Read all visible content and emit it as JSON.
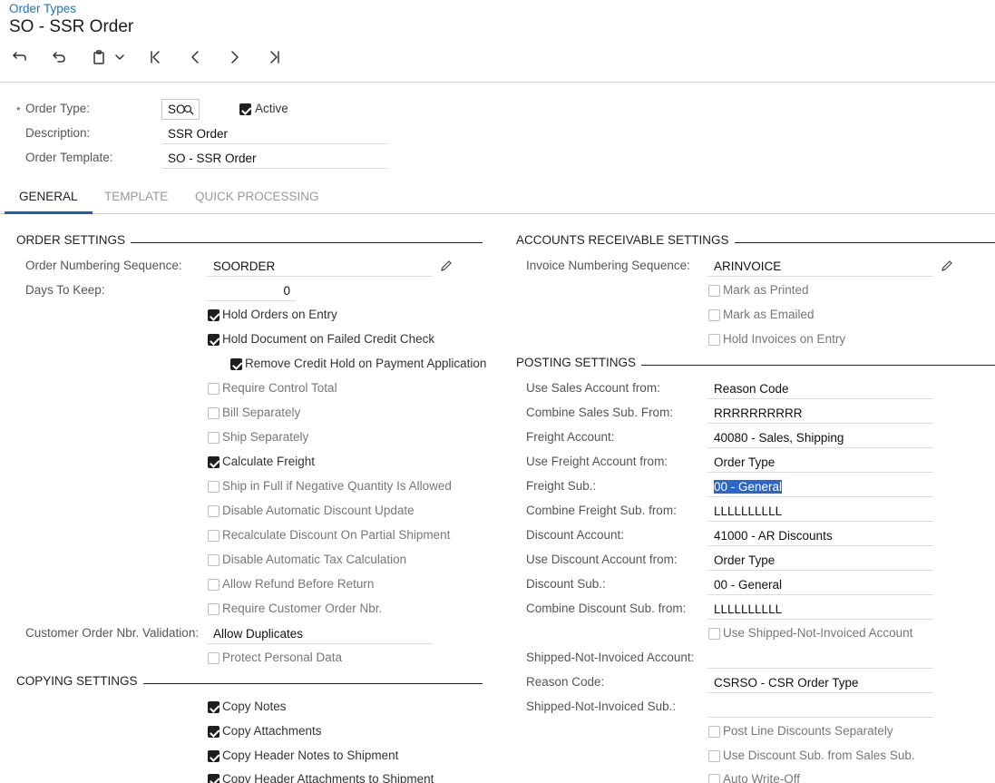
{
  "breadcrumb": "Order Types",
  "title": "SO - SSR Order",
  "toolbar": [
    "undo-arrow-icon",
    "undo-icon",
    "clipboard-icon",
    "chevron-down-icon",
    "first-record-icon",
    "prev-record-icon",
    "next-record-icon",
    "last-record-icon"
  ],
  "header": {
    "order_type_label": "Order Type:",
    "order_type_value": "SO",
    "active_label": "Active",
    "active_checked": true,
    "description_label": "Description:",
    "description_value": "SSR Order",
    "template_label": "Order Template:",
    "template_value": "SO - SSR Order"
  },
  "tabs": [
    "GENERAL",
    "TEMPLATE",
    "QUICK PROCESSING"
  ],
  "order_settings": {
    "title": "ORDER SETTINGS",
    "numbering_label": "Order Numbering Sequence:",
    "numbering_value": "SOORDER",
    "days_label": "Days To Keep:",
    "days_value": "0",
    "checkboxes": [
      {
        "label": "Hold Orders on Entry",
        "checked": true
      },
      {
        "label": "Hold Document on Failed Credit Check",
        "checked": true
      },
      {
        "label": "Remove Credit Hold on Payment Application",
        "checked": true
      },
      {
        "label": "Require Control Total",
        "checked": false
      },
      {
        "label": "Bill Separately",
        "checked": false
      },
      {
        "label": "Ship Separately",
        "checked": false
      },
      {
        "label": "Calculate Freight",
        "checked": true
      },
      {
        "label": "Ship in Full if Negative Quantity Is Allowed",
        "checked": false
      },
      {
        "label": "Disable Automatic Discount Update",
        "checked": false
      },
      {
        "label": "Recalculate Discount On Partial Shipment",
        "checked": false
      },
      {
        "label": "Disable Automatic Tax Calculation",
        "checked": false
      },
      {
        "label": "Allow Refund Before Return",
        "checked": false
      },
      {
        "label": "Require Customer Order Nbr.",
        "checked": false
      }
    ],
    "validation_label": "Customer Order Nbr. Validation:",
    "validation_value": "Allow Duplicates",
    "protect_label": "Protect Personal Data",
    "protect_checked": false
  },
  "copying_settings": {
    "title": "COPYING SETTINGS",
    "checkboxes": [
      {
        "label": "Copy Notes",
        "checked": true
      },
      {
        "label": "Copy Attachments",
        "checked": true
      },
      {
        "label": "Copy Header Notes to Shipment",
        "checked": true
      },
      {
        "label": "Copy Header Attachments to Shipment",
        "checked": true
      }
    ]
  },
  "ar_settings": {
    "title": "ACCOUNTS RECEIVABLE SETTINGS",
    "invoice_label": "Invoice Numbering Sequence:",
    "invoice_value": "ARINVOICE",
    "checkboxes": [
      {
        "label": "Mark as Printed",
        "checked": false
      },
      {
        "label": "Mark as Emailed",
        "checked": false
      },
      {
        "label": "Hold Invoices on Entry",
        "checked": false
      }
    ]
  },
  "posting_settings": {
    "title": "POSTING SETTINGS",
    "rows": [
      {
        "label": "Use Sales Account from:",
        "value": "Reason Code"
      },
      {
        "label": "Combine Sales Sub. From:",
        "value": "RRRRRRRRRR"
      },
      {
        "label": "Freight Account:",
        "value": "40080 - Sales, Shipping"
      },
      {
        "label": "Use Freight Account from:",
        "value": "Order Type"
      },
      {
        "label": "Freight Sub.:",
        "value": "00 - General"
      },
      {
        "label": "Combine Freight Sub. from:",
        "value": "LLLLLLLLLL"
      },
      {
        "label": "Discount Account:",
        "value": "41000 - AR Discounts"
      },
      {
        "label": "Use Discount Account from:",
        "value": "Order Type"
      },
      {
        "label": "Discount Sub.:",
        "value": "00 - General"
      },
      {
        "label": "Combine Discount Sub. from:",
        "value": "LLLLLLLLLL"
      }
    ],
    "use_sni_label": "Use Shipped-Not-Invoiced Account",
    "sni_account_label": "Shipped-Not-Invoiced Account:",
    "sni_account_value": "",
    "reason_label": "Reason Code:",
    "reason_value": "CSRSO - CSR Order Type",
    "sni_sub_label": "Shipped-Not-Invoiced Sub.:",
    "sni_sub_value": "",
    "post_line_label": "Post Line Discounts Separately",
    "use_disc_sub_label": "Use Discount Sub. from Sales Sub.",
    "auto_writeoff_label": "Auto Write-Off"
  }
}
